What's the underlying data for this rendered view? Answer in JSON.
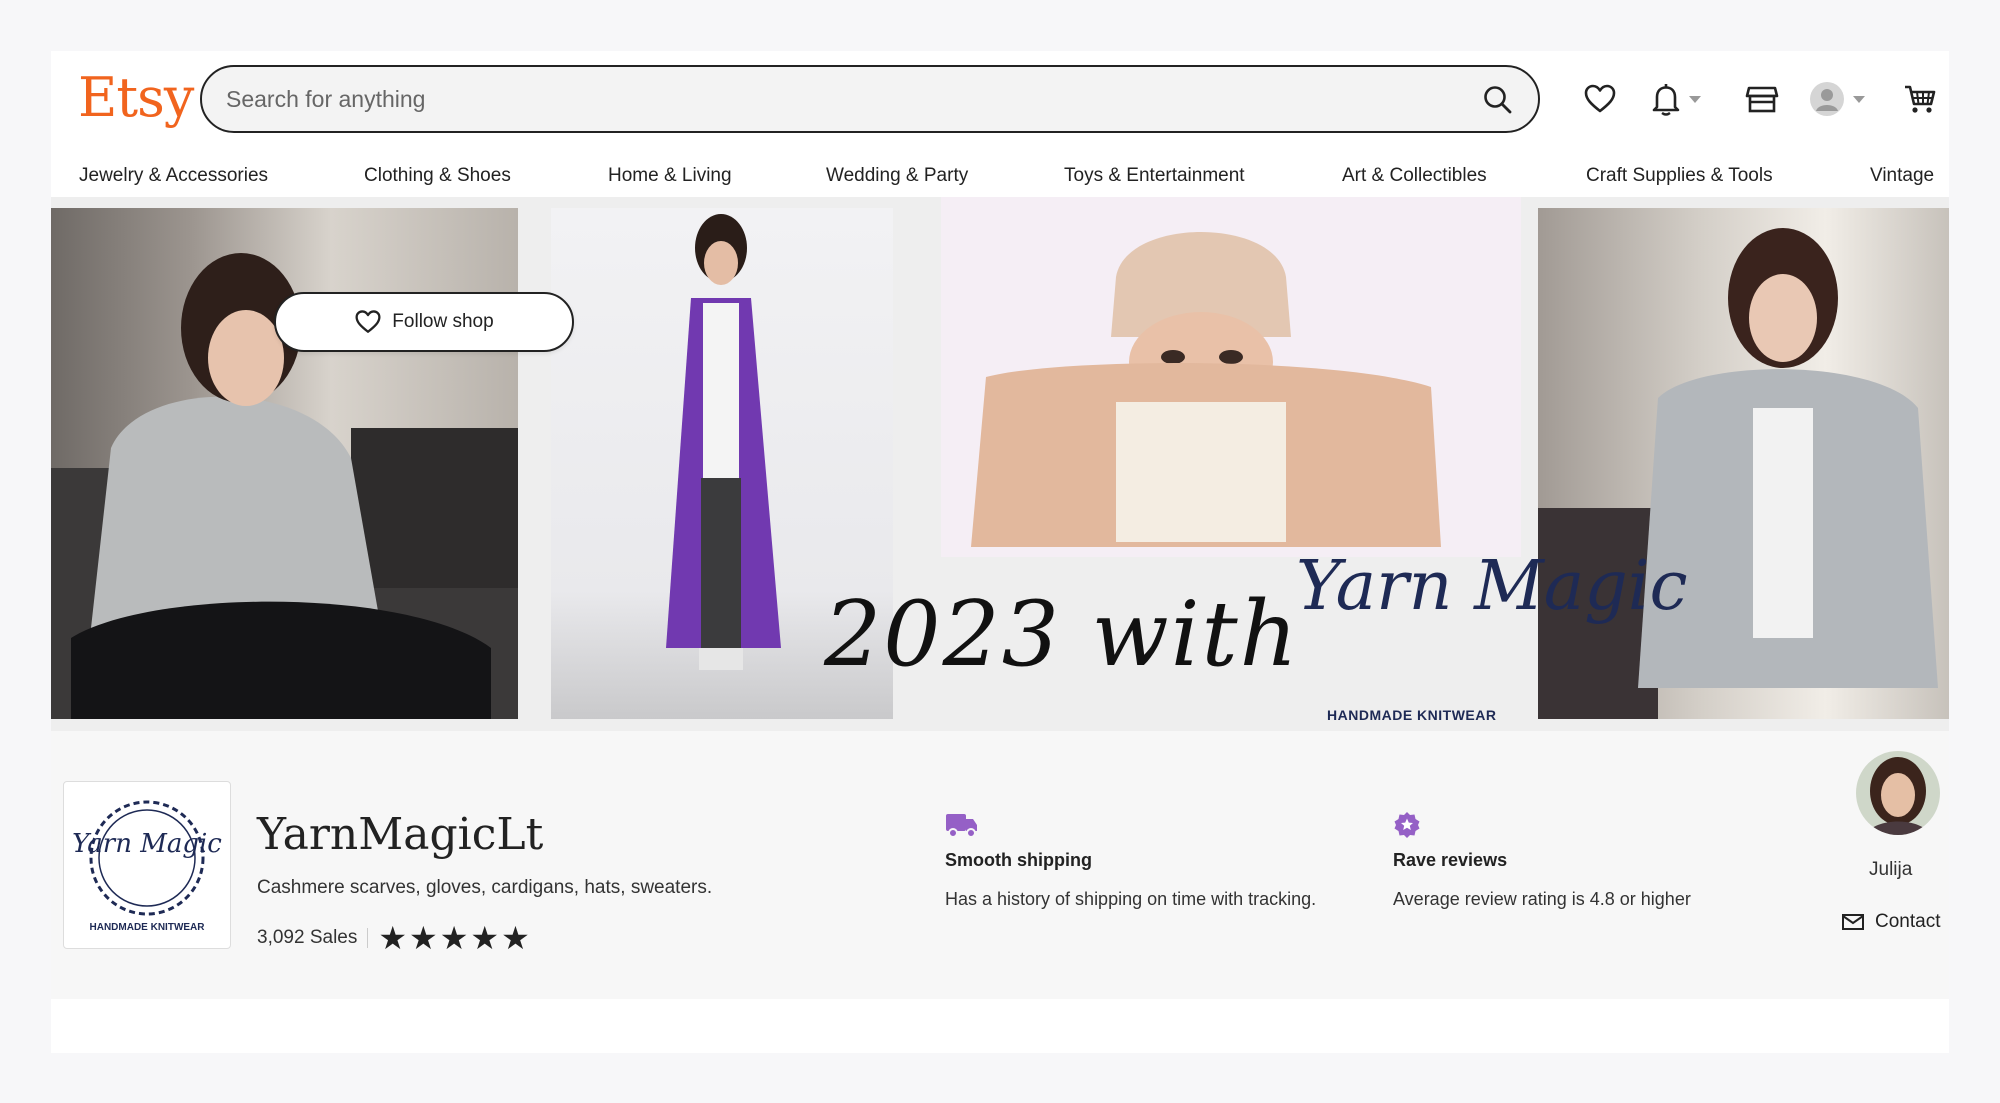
{
  "header": {
    "logo": "Etsy",
    "search_placeholder": "Search for anything"
  },
  "categories": [
    "Jewelry & Accessories",
    "Clothing & Shoes",
    "Home & Living",
    "Wedding & Party",
    "Toys & Entertainment",
    "Art & Collectibles",
    "Craft Supplies & Tools",
    "Vintage"
  ],
  "banner": {
    "text": "2023 with",
    "logo_text": "Yarn Magic",
    "logo_sub": "HANDMADE KNITWEAR"
  },
  "shop": {
    "logo_text": "Yarn Magic",
    "logo_sub": "HANDMADE KNITWEAR",
    "name": "YarnMagicLt",
    "tagline": "Cashmere scarves, gloves, cardigans, hats, sweaters.",
    "sales": "3,092 Sales",
    "rating_stars": 5,
    "follow_label": "Follow shop"
  },
  "perks": [
    {
      "icon": "truck-icon",
      "title": "Smooth shipping",
      "desc": "Has a history of shipping on time with tracking."
    },
    {
      "icon": "star-badge-icon",
      "title": "Rave reviews",
      "desc": "Average review rating is 4.8 or higher"
    }
  ],
  "owner": {
    "name": "Julija",
    "contact_label": "Contact"
  },
  "colors": {
    "brand": "#f1641e",
    "perk_icon": "#9560c6"
  }
}
